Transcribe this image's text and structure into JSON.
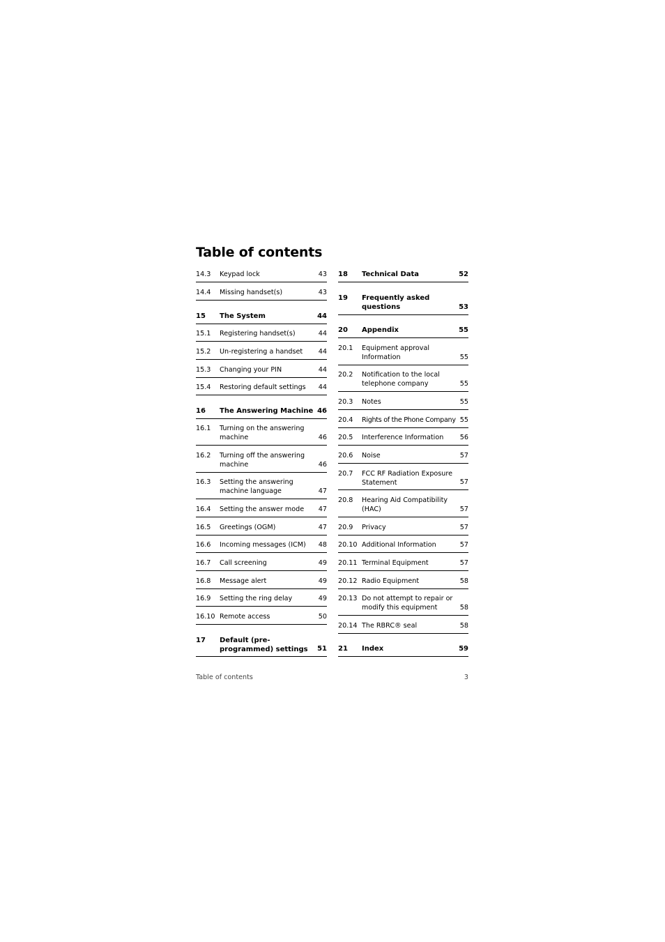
{
  "title": "Table of contents",
  "left_column": [
    {
      "num": "14.3",
      "label": "Keypad lock",
      "page": "43",
      "chapter": false
    },
    {
      "num": "14.4",
      "label": "Missing handset(s)",
      "page": "43",
      "chapter": false
    },
    {
      "num": "15",
      "label": "The System",
      "page": "44",
      "chapter": true
    },
    {
      "num": "15.1",
      "label": "Registering handset(s)",
      "page": "44",
      "chapter": false
    },
    {
      "num": "15.2",
      "label": "Un-registering a handset",
      "page": "44",
      "chapter": false
    },
    {
      "num": "15.3",
      "label": "Changing your PIN",
      "page": "44",
      "chapter": false
    },
    {
      "num": "15.4",
      "label": "Restoring default settings",
      "page": "44",
      "chapter": false
    },
    {
      "num": "16",
      "label": "The Answering Machine",
      "page": "46",
      "chapter": true
    },
    {
      "num": "16.1",
      "label": "Turning on the answering machine",
      "page": "46",
      "chapter": false
    },
    {
      "num": "16.2",
      "label": "Turning off the answering machine",
      "page": "46",
      "chapter": false
    },
    {
      "num": "16.3",
      "label": "Setting the answering machine language",
      "page": "47",
      "chapter": false
    },
    {
      "num": "16.4",
      "label": "Setting the answer mode",
      "page": "47",
      "chapter": false
    },
    {
      "num": "16.5",
      "label": "Greetings (OGM)",
      "page": "47",
      "chapter": false
    },
    {
      "num": "16.6",
      "label": "Incoming messages (ICM)",
      "page": "48",
      "chapter": false
    },
    {
      "num": "16.7",
      "label": "Call screening",
      "page": "49",
      "chapter": false
    },
    {
      "num": "16.8",
      "label": "Message alert",
      "page": "49",
      "chapter": false
    },
    {
      "num": "16.9",
      "label": "Setting the ring delay",
      "page": "49",
      "chapter": false
    },
    {
      "num": "16.10",
      "label": "Remote access",
      "page": "50",
      "chapter": false
    },
    {
      "num": "17",
      "label": "Default (pre-programmed) settings",
      "page": "51",
      "chapter": true
    }
  ],
  "right_column": [
    {
      "num": "18",
      "label": "Technical Data",
      "page": "52",
      "chapter": true
    },
    {
      "num": "19",
      "label": "Frequently asked questions",
      "page": "53",
      "chapter": true
    },
    {
      "num": "20",
      "label": "Appendix",
      "page": "55",
      "chapter": true
    },
    {
      "num": "20.1",
      "label": "Equipment approval Information",
      "page": "55",
      "chapter": false
    },
    {
      "num": "20.2",
      "label": "Notification to the local telephone company",
      "page": "55",
      "chapter": false
    },
    {
      "num": "20.3",
      "label": "Notes",
      "page": "55",
      "chapter": false
    },
    {
      "num": "20.4",
      "label": "Rights of the Phone Company",
      "page": "55",
      "chapter": false
    },
    {
      "num": "20.5",
      "label": "Interference Information",
      "page": "56",
      "chapter": false
    },
    {
      "num": "20.6",
      "label": "Noise",
      "page": "57",
      "chapter": false
    },
    {
      "num": "20.7",
      "label": "FCC RF Radiation Exposure Statement",
      "page": "57",
      "chapter": false
    },
    {
      "num": "20.8",
      "label": "Hearing Aid Compatibility (HAC)",
      "page": "57",
      "chapter": false
    },
    {
      "num": "20.9",
      "label": "Privacy",
      "page": "57",
      "chapter": false
    },
    {
      "num": "20.10",
      "label": "Additional Information",
      "page": "57",
      "chapter": false
    },
    {
      "num": "20.11",
      "label": "Terminal Equipment",
      "page": "57",
      "chapter": false
    },
    {
      "num": "20.12",
      "label": "Radio Equipment",
      "page": "58",
      "chapter": false
    },
    {
      "num": "20.13",
      "label": "Do not attempt to repair or modify this equipment",
      "page": "58",
      "chapter": false
    },
    {
      "num": "20.14",
      "label": "The RBRC® seal",
      "page": "58",
      "chapter": false
    },
    {
      "num": "21",
      "label": "Index",
      "page": "59",
      "chapter": true
    }
  ],
  "footer": {
    "section_title": "Table of contents",
    "page_number": "3"
  }
}
